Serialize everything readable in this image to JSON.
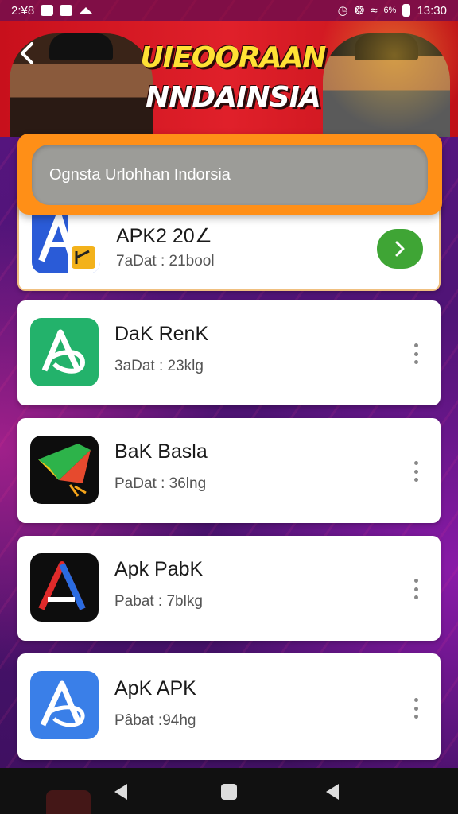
{
  "status_bar": {
    "left_text": "2:¥8",
    "battery_text": "6%",
    "time": "13:30"
  },
  "banner": {
    "title_line1": "UIEOORAAN",
    "title_line2": "NNDAINSIA"
  },
  "search": {
    "placeholder": "Ognsta Urlohhan Indorsia"
  },
  "apps": [
    {
      "name": "APK2 20∠",
      "meta": "7aDat : 21bool",
      "action": "open"
    },
    {
      "name": "DaK RenK",
      "meta": "3aDat : 23klg",
      "action": "menu"
    },
    {
      "name": "BaK Basla",
      "meta": "PaDat : 36lng",
      "action": "menu"
    },
    {
      "name": "Apk PabK",
      "meta": "Pabat : 7blkg",
      "action": "menu"
    },
    {
      "name": "ApK APK",
      "meta": "Pâbat :94hg",
      "action": "menu"
    }
  ],
  "colors": {
    "accent_orange": "#ff8f17",
    "go_green": "#3fa535",
    "banner_red": "#d8141e"
  }
}
